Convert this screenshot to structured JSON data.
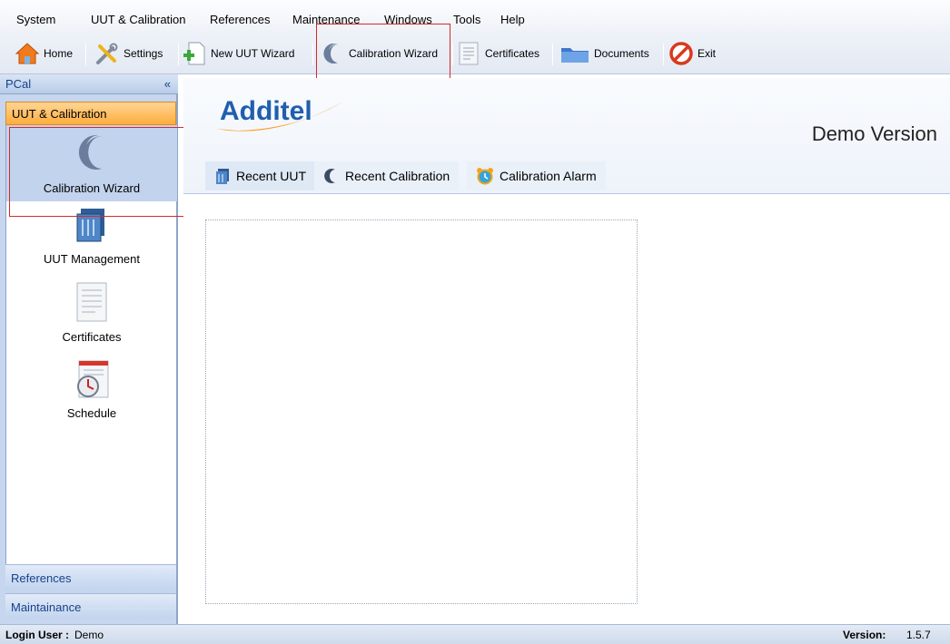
{
  "menu": [
    "System",
    "UUT & Calibration",
    "References",
    "Maintenance",
    "Windows",
    "Tools",
    "Help"
  ],
  "toolbar": {
    "home": "Home",
    "settings": "Settings",
    "new_uut_wizard": "New UUT Wizard",
    "calibration_wizard": "Calibration Wizard",
    "certificates": "Certificates",
    "documents": "Documents",
    "exit": "Exit"
  },
  "sidebar": {
    "header": "PCal",
    "collapse_glyph": "«",
    "active_section": "UUT & Calibration",
    "items": [
      {
        "label": "Calibration Wizard",
        "icon": "calibration-wizard-icon"
      },
      {
        "label": "UUT Management",
        "icon": "uut-management-icon"
      },
      {
        "label": "Certificates",
        "icon": "certificates-icon"
      },
      {
        "label": "Schedule",
        "icon": "schedule-icon"
      }
    ],
    "sections": [
      "References",
      "Maintainance"
    ]
  },
  "main": {
    "logo_text": "Additel",
    "edition": "Demo Version",
    "tabs": [
      "Recent UUT",
      "Recent Calibration",
      "Calibration Alarm"
    ]
  },
  "status": {
    "login_label": "Login User :",
    "login_user": "Demo",
    "version_label": "Version:",
    "version": "1.5.7"
  },
  "colors": {
    "accent": "#ff9f2e",
    "highlight_box": "#d42a2a",
    "panel_blue": "#c6d6ee"
  }
}
